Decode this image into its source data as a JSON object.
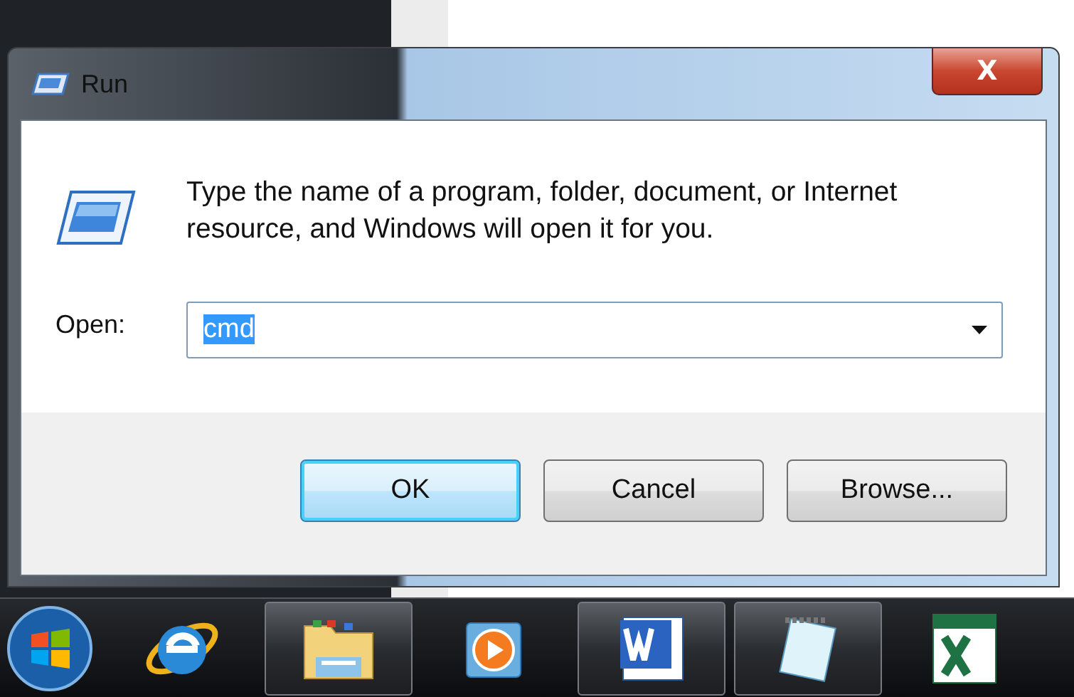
{
  "dialog": {
    "title": "Run",
    "close_label": "X",
    "message": "Type the name of a program, folder, document, or Internet resource, and Windows will open it for you.",
    "open_label": "Open:",
    "open_field": {
      "value": "cmd",
      "text_selected": true
    },
    "buttons": [
      {
        "label": "OK",
        "default": true
      },
      {
        "label": "Cancel",
        "default": false
      },
      {
        "label": "Browse...",
        "default": false
      }
    ]
  },
  "taskbar": {
    "items": [
      {
        "kind": "start",
        "active": false
      },
      {
        "kind": "browser",
        "active": false
      },
      {
        "kind": "folder",
        "active": true
      },
      {
        "kind": "media",
        "active": false
      },
      {
        "kind": "word",
        "active": true
      },
      {
        "kind": "notepad",
        "active": true
      },
      {
        "kind": "excel",
        "active": false
      }
    ]
  }
}
